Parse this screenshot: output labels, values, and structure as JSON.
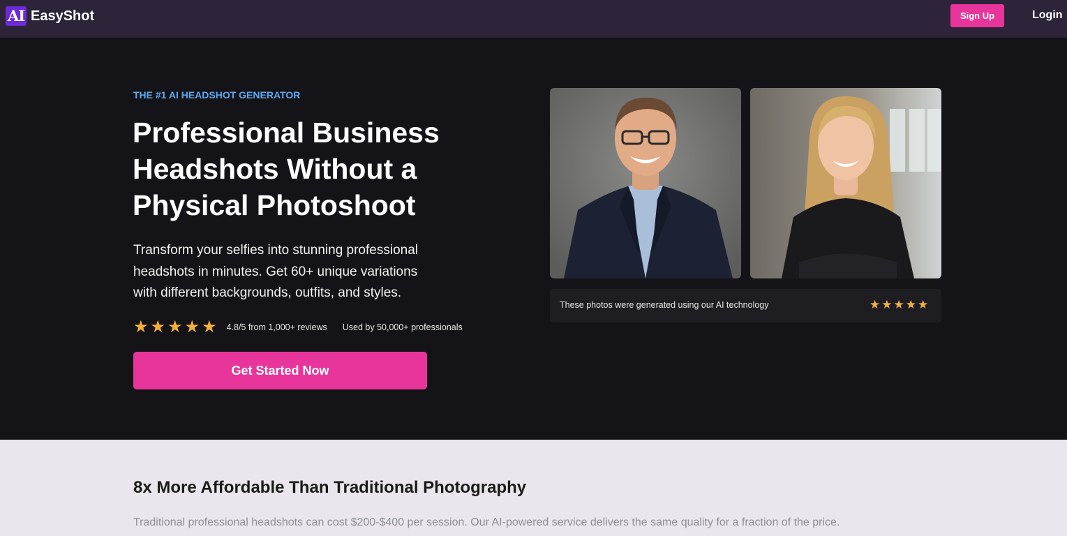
{
  "nav": {
    "logo_mark": "AI",
    "brand": "EasyShot",
    "signup_label": "Sign Up",
    "login_label": "Login"
  },
  "hero": {
    "eyebrow": "THE #1 AI HEADSHOT GENERATOR",
    "headline": "Professional Business Headshots Without a Physical Photoshoot",
    "subtext": "Transform your selfies into stunning professional headshots in minutes. Get 60+ unique variations with different backgrounds, outfits, and styles.",
    "rating": {
      "stars": 5,
      "text": "4.8/5 from 1,000+ reviews"
    },
    "used_by": "Used by 50,000+ professionals",
    "cta_label": "Get Started Now"
  },
  "gallery": {
    "caption": "These photos were generated using our AI technology",
    "stars": 5
  },
  "section2": {
    "title": "8x More Affordable Than Traditional Photography",
    "body": "Traditional professional headshots can cost $200-$400 per session. Our AI-powered service delivers the same quality for a fraction of the price."
  },
  "colors": {
    "accent": "#e8359c",
    "eyebrow": "#5aa9f0",
    "star": "#f6b13b",
    "nav_bg": "#2e2439",
    "hero_bg": "#141418"
  }
}
